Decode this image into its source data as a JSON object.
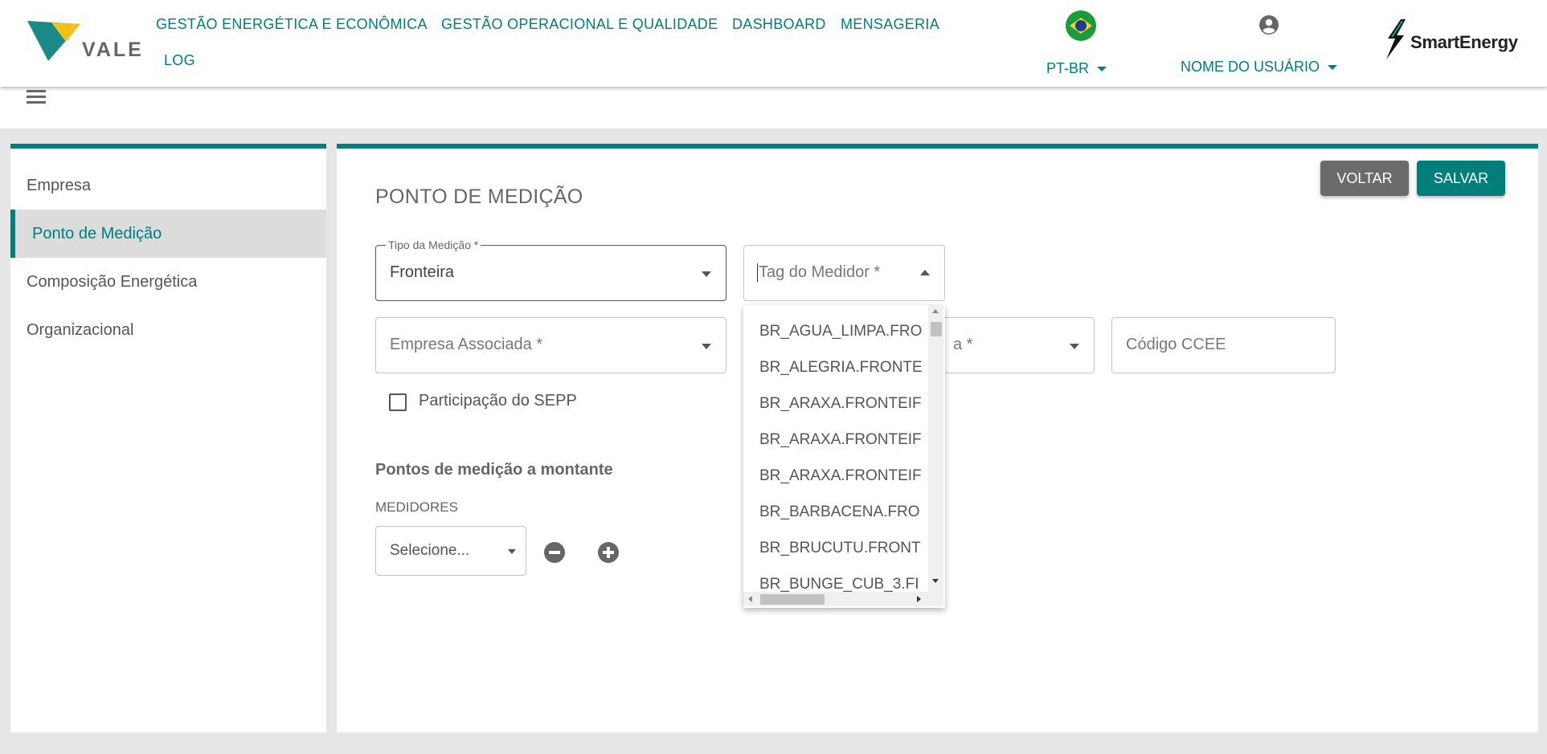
{
  "header": {
    "logo_text": "VALE",
    "nav": [
      {
        "label": "GESTÃO ENERGÉTICA E ECONÔMICA"
      },
      {
        "label": "GESTÃO OPERACIONAL E QUALIDADE"
      },
      {
        "label": "DASHBOARD"
      },
      {
        "label": "MENSAGERIA"
      },
      {
        "label": "LOG"
      }
    ],
    "language": "PT-BR",
    "user_name": "NOME DO USUÁRIO",
    "brand": "SmartEnergy"
  },
  "colors": {
    "accent": "#007e7a",
    "back_button": "#6b6b6b"
  },
  "sidebar": {
    "items": [
      {
        "label": "Empresa"
      },
      {
        "label": "Ponto de Medição"
      },
      {
        "label": "Composição Energética"
      },
      {
        "label": "Organizacional"
      }
    ],
    "active": "Ponto de Medição"
  },
  "main": {
    "title": "PONTO DE MEDIÇÃO",
    "back_label": "VOLTAR",
    "save_label": "SALVAR",
    "tipo_medicao": {
      "label": "Tipo da Medição *",
      "value": "Fronteira"
    },
    "tag_medidor": {
      "placeholder": "Tag do Medidor *"
    },
    "empresa_associada": {
      "placeholder": "Empresa Associada *"
    },
    "hidden_select": {
      "placeholder_fragment": "a *"
    },
    "codigo_ccee": {
      "placeholder": "Código CCEE"
    },
    "sepp": {
      "label": "Participação do SEPP"
    },
    "montante": {
      "title": "Pontos de medição a montante",
      "subtitle": "MEDIDORES",
      "select_placeholder": "Selecione..."
    },
    "tag_options": [
      "BR_AGUA_LIMPA.FRO",
      "BR_ALEGRIA.FRONTE",
      "BR_ARAXA.FRONTEIF",
      "BR_ARAXA.FRONTEIF",
      "BR_ARAXA.FRONTEIF",
      "BR_BARBACENA.FRO",
      "BR_BRUCUTU.FRONT",
      "BR_BUNGE_CUB_3.FI"
    ]
  }
}
